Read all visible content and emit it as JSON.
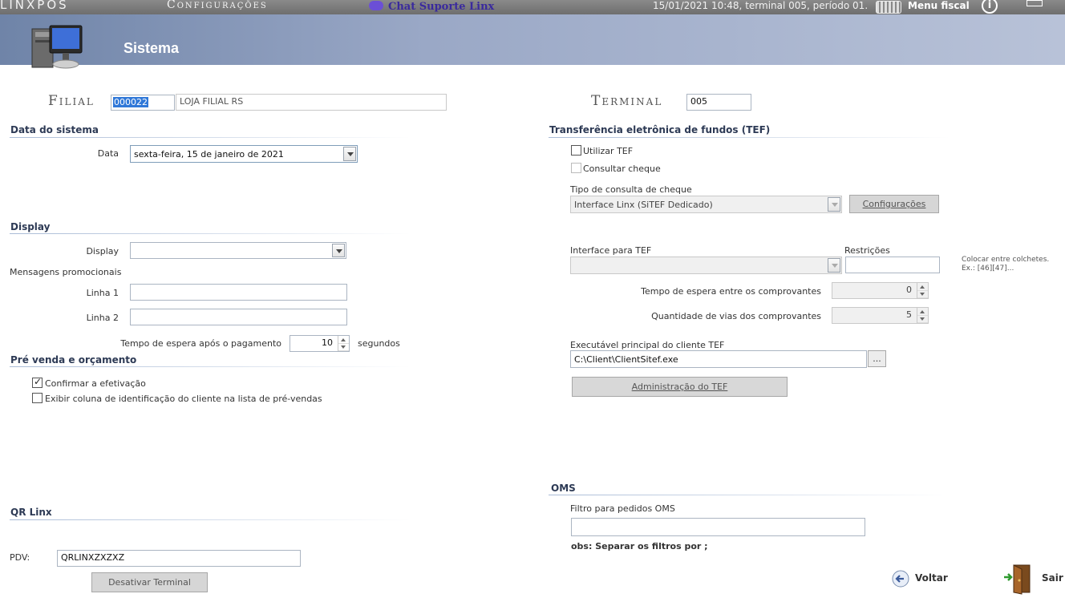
{
  "topbar": {
    "brand": "LINXPOS",
    "section": "Configurações",
    "chat": "Chat Suporte Linx",
    "status": "15/01/2021 10:48, terminal 005, período 01.",
    "menu": "Menu fiscal",
    "info": "i"
  },
  "header": {
    "title": "Sistema"
  },
  "filial": {
    "label": "Filial",
    "code": "000022",
    "name": "LOJA FILIAL RS"
  },
  "terminal": {
    "label": "Terminal",
    "value": "005"
  },
  "data_sistema": {
    "section": "Data do sistema",
    "data_label": "Data",
    "data_value": "sexta-feira, 15 de janeiro de 2021"
  },
  "display": {
    "section": "Display",
    "display_label": "Display",
    "display_value": "",
    "mensagens_label": "Mensagens promocionais",
    "linha1_label": "Linha 1",
    "linha1_value": "",
    "linha2_label": "Linha 2",
    "linha2_value": "",
    "tempo_label": "Tempo de espera após o pagamento",
    "tempo_value": "10",
    "segundos_label": "segundos"
  },
  "prevenda": {
    "section": "Pré venda e orçamento",
    "confirmar_label": "Confirmar a efetivação",
    "confirmar_checked": true,
    "exibir_label": "Exibir coluna de identificação do cliente na lista de pré-vendas",
    "exibir_checked": false
  },
  "qrlinx": {
    "section": "QR Linx",
    "pdv_label": "PDV:",
    "pdv_value": "QRLINXZXZXZ",
    "desativar_label": "Desativar Terminal"
  },
  "tef": {
    "section": "Transferência eletrônica de fundos (TEF)",
    "utilizar_label": "Utilizar TEF",
    "utilizar_checked": false,
    "consultar_label": "Consultar cheque",
    "consultar_checked": false,
    "tipo_label": "Tipo de consulta de cheque",
    "tipo_value": "Interface Linx (SiTEF Dedicado)",
    "config_button": "Configurações",
    "interface_label": "Interface para TEF",
    "interface_value": "",
    "restricoes_label": "Restrições",
    "restricoes_value": "",
    "restricoes_hint_1": "Colocar entre colchetes.",
    "restricoes_hint_2": "Ex.: [46][47]...",
    "tempo_label": "Tempo de espera entre os comprovantes",
    "tempo_value": "0",
    "vias_label": "Quantidade de vias dos comprovantes",
    "vias_value": "5",
    "exec_label": "Executável principal do cliente TEF",
    "exec_value": "C:\\Client\\ClientSitef.exe",
    "browse_label": "...",
    "admin_button": "Administração do TEF"
  },
  "oms": {
    "section": "OMS",
    "filtro_label": "Filtro para pedidos OMS",
    "filtro_value": "",
    "obs": "obs: Separar os filtros por ;"
  },
  "nav": {
    "voltar": "Voltar",
    "sair": "Sair"
  }
}
